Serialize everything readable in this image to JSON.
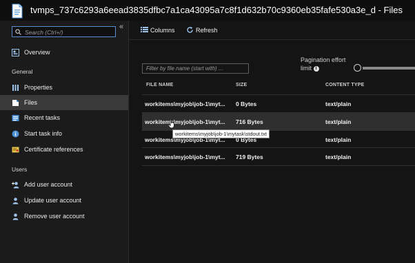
{
  "window": {
    "title": "tvmps_737c6293a6eead3835dfbc7a1ca43095a7c8f1d632b70c9360eb35fafe530a3e_d - Files"
  },
  "sidebar": {
    "search_placeholder": "Search (Ctrl+/)",
    "collapse_glyph": "«",
    "overview": {
      "label": "Overview",
      "icon": "overview-icon"
    },
    "sections": [
      {
        "title": "General",
        "items": [
          {
            "label": "Properties",
            "icon": "properties-icon",
            "selected": false
          },
          {
            "label": "Files",
            "icon": "files-icon",
            "selected": true
          },
          {
            "label": "Recent tasks",
            "icon": "recent-tasks-icon",
            "selected": false
          },
          {
            "label": "Start task info",
            "icon": "info-icon",
            "selected": false
          },
          {
            "label": "Certificate references",
            "icon": "certificate-icon",
            "selected": false
          }
        ]
      },
      {
        "title": "Users",
        "items": [
          {
            "label": "Add user account",
            "icon": "add-user-icon",
            "selected": false
          },
          {
            "label": "Update user account",
            "icon": "update-user-icon",
            "selected": false
          },
          {
            "label": "Remove user account",
            "icon": "remove-user-icon",
            "selected": false
          }
        ]
      }
    ]
  },
  "toolbar": {
    "columns_label": "Columns",
    "refresh_label": "Refresh"
  },
  "filter": {
    "placeholder": "Filter by file name (start with) ..."
  },
  "pagination": {
    "label_line1": "Pagination effort",
    "label_line2": "limit",
    "info_glyph": "i"
  },
  "table": {
    "columns": [
      "FILE NAME",
      "SIZE",
      "CONTENT TYPE"
    ],
    "rows": [
      {
        "name": "workitems\\myjob\\job-1\\myt...",
        "size": "0 Bytes",
        "type": "text/plain"
      },
      {
        "name": "workitems\\myjob\\job-1\\myt...",
        "size": "716 Bytes",
        "type": "text/plain"
      },
      {
        "name": "workitems\\myjob\\job-1\\myt...",
        "size": "0 Bytes",
        "type": "text/plain"
      },
      {
        "name": "workitems\\myjob\\job-1\\myt...",
        "size": "719 Bytes",
        "type": "text/plain"
      }
    ]
  },
  "tooltip": {
    "text": "workitems\\myjob\\job-1\\mytask\\stdout.txt"
  },
  "colors": {
    "accent": "#5a8fd0",
    "background": "#141414",
    "sidebar": "#1b1b1b",
    "selected": "#3a3a3a"
  }
}
